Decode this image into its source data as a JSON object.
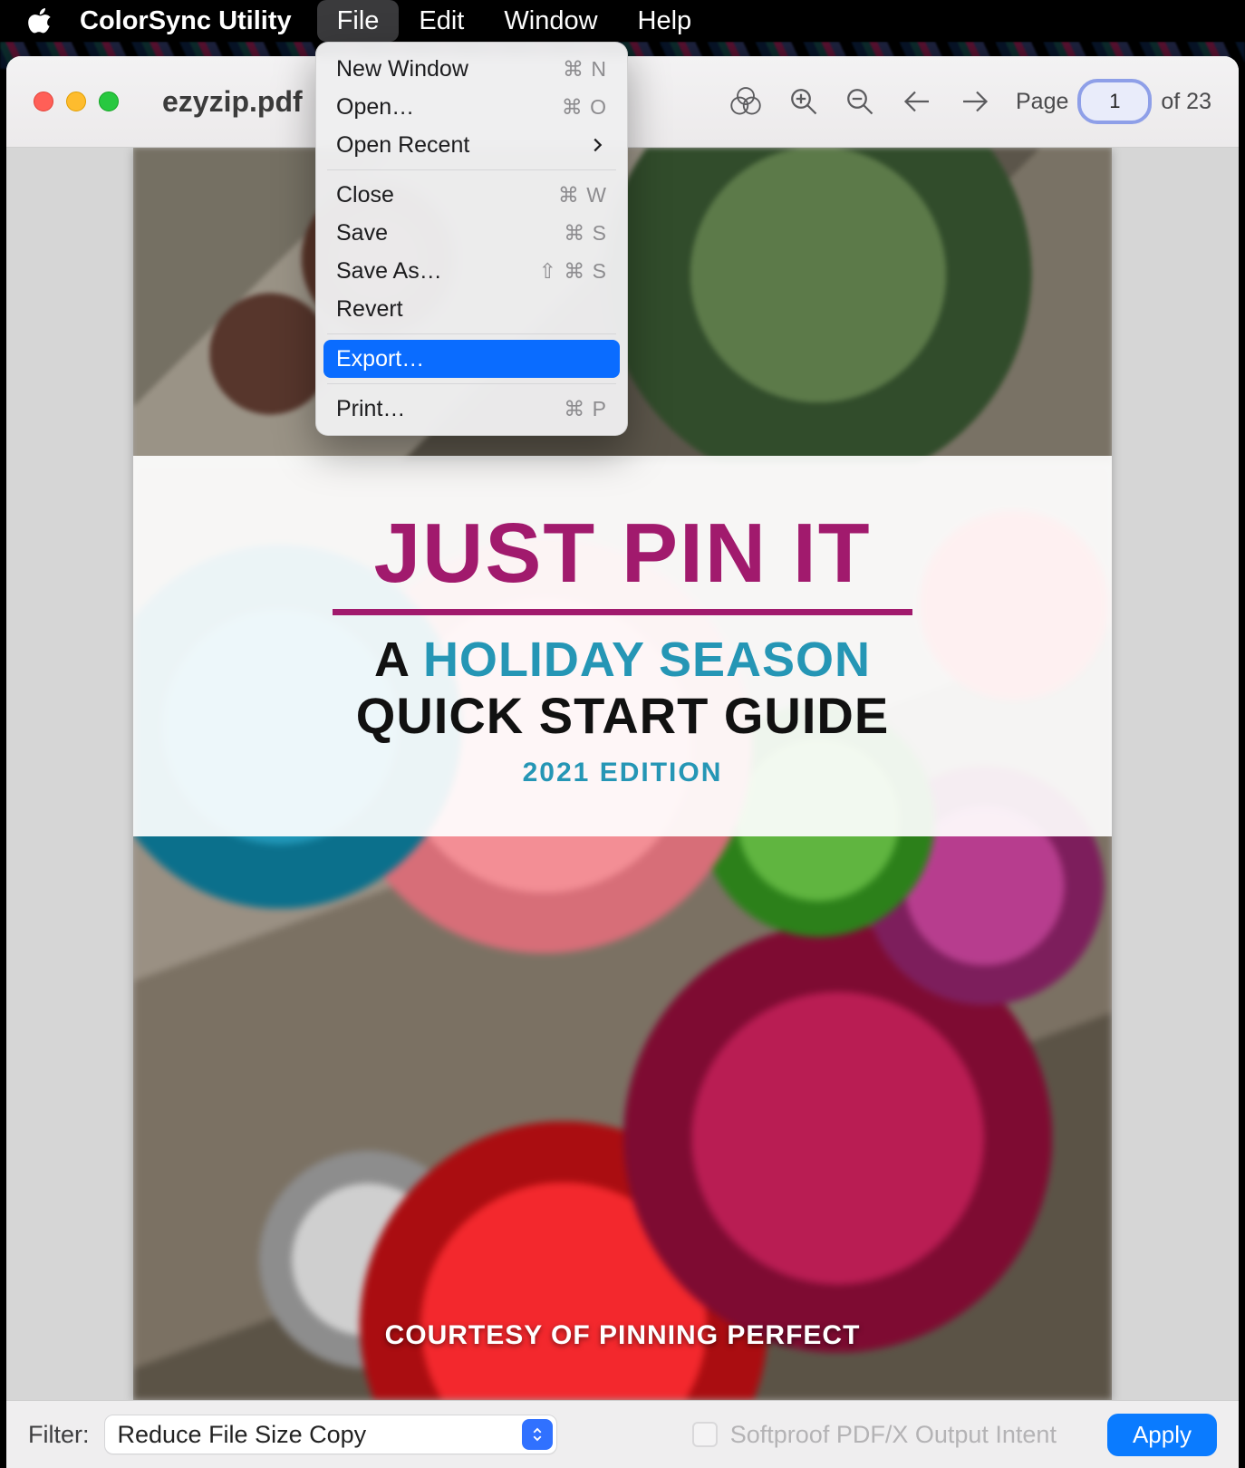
{
  "menubar": {
    "app_name": "ColorSync Utility",
    "items": [
      "File",
      "Edit",
      "Window",
      "Help"
    ],
    "active_index": 0
  },
  "window": {
    "doc_title": "ezyzip.pdf"
  },
  "toolbar": {
    "page_label": "Page",
    "page_current": "1",
    "page_of": "of 23"
  },
  "file_menu": {
    "items": [
      {
        "label": "New Window",
        "shortcut": "⌘ N",
        "type": "item"
      },
      {
        "label": "Open…",
        "shortcut": "⌘ O",
        "type": "item"
      },
      {
        "label": "Open Recent",
        "shortcut": "",
        "type": "submenu"
      },
      {
        "type": "separator"
      },
      {
        "label": "Close",
        "shortcut": "⌘ W",
        "type": "item"
      },
      {
        "label": "Save",
        "shortcut": "⌘  S",
        "type": "item"
      },
      {
        "label": "Save As…",
        "shortcut": "⇧ ⌘  S",
        "type": "item"
      },
      {
        "label": "Revert",
        "shortcut": "",
        "type": "item"
      },
      {
        "type": "separator"
      },
      {
        "label": "Export…",
        "shortcut": "",
        "type": "item",
        "highlight": true
      },
      {
        "type": "separator"
      },
      {
        "label": "Print…",
        "shortcut": "⌘  P",
        "type": "item"
      }
    ]
  },
  "document": {
    "title": "JUST PIN IT",
    "line2_a": "A ",
    "line2_b": "HOLIDAY SEASON",
    "line3": "QUICK START GUIDE",
    "edition": "2021 EDITION",
    "footer": "COURTESY OF PINNING PERFECT"
  },
  "bottombar": {
    "filter_label": "Filter:",
    "filter_value": "Reduce File Size Copy",
    "softproof_label": "Softproof PDF/X Output Intent",
    "apply_label": "Apply"
  }
}
